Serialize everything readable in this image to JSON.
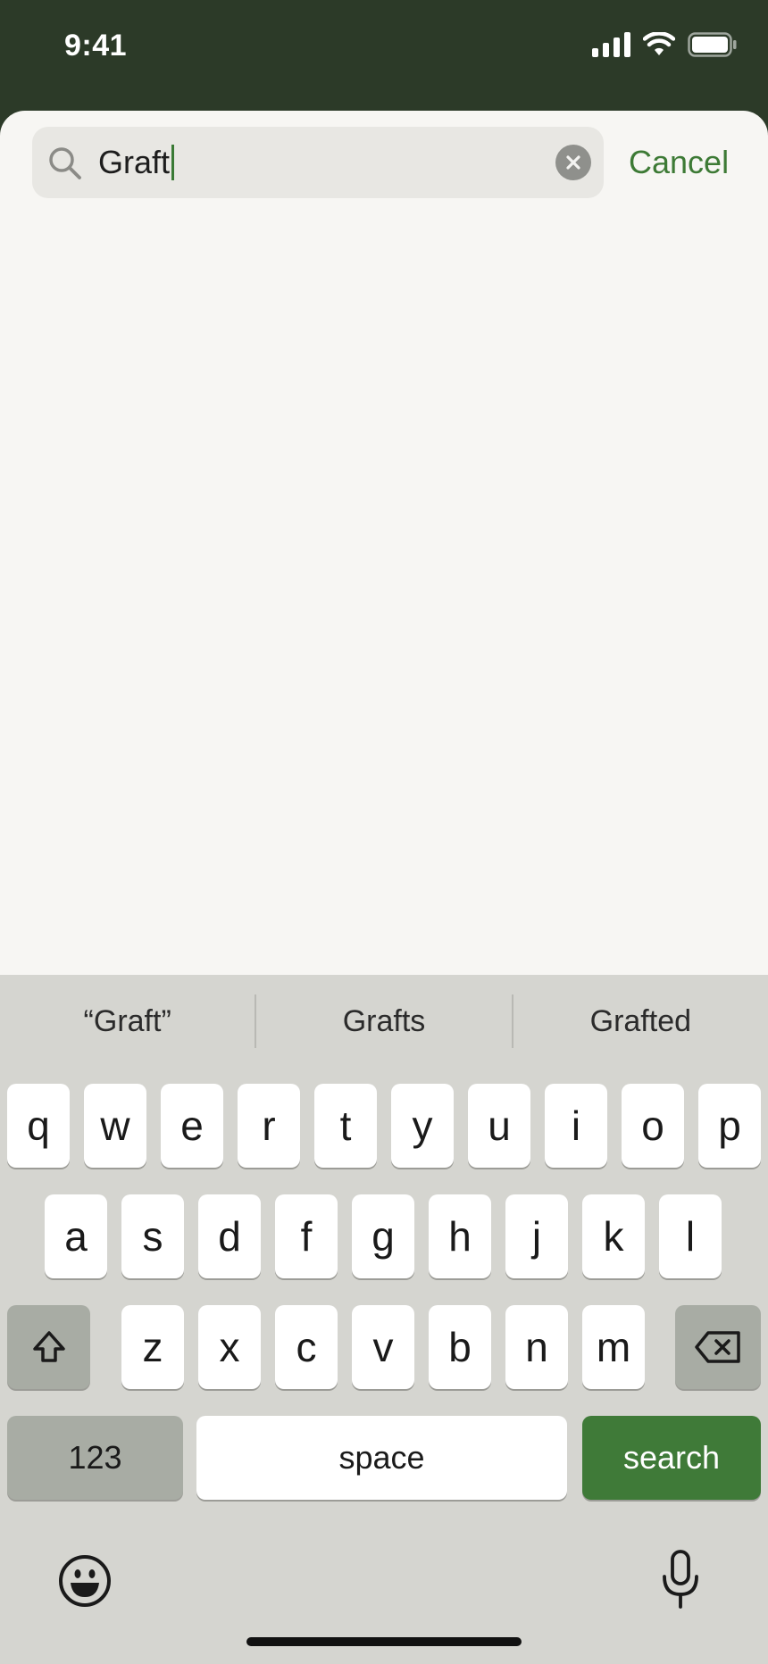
{
  "status_bar": {
    "time": "9:41"
  },
  "search": {
    "query": "Graft",
    "cancel_label": "Cancel"
  },
  "keyboard": {
    "suggestions": [
      "“Graft”",
      "Grafts",
      "Grafted"
    ],
    "row1": [
      "q",
      "w",
      "e",
      "r",
      "t",
      "y",
      "u",
      "i",
      "o",
      "p"
    ],
    "row2": [
      "a",
      "s",
      "d",
      "f",
      "g",
      "h",
      "j",
      "k",
      "l"
    ],
    "row3": [
      "z",
      "x",
      "c",
      "v",
      "b",
      "n",
      "m"
    ],
    "numbers_label": "123",
    "space_label": "space",
    "search_label": "search"
  },
  "colors": {
    "header_bg": "#2c3a28",
    "accent_green": "#3f7a38",
    "sheet_bg": "#f7f6f3",
    "keyboard_bg": "#d5d5d0"
  },
  "icons": {
    "search": "search-icon",
    "clear": "clear-icon",
    "shift": "shift-icon",
    "delete": "delete-icon",
    "emoji": "emoji-icon",
    "microphone": "microphone-icon",
    "signal": "signal-icon",
    "wifi": "wifi-icon",
    "battery": "battery-icon"
  }
}
